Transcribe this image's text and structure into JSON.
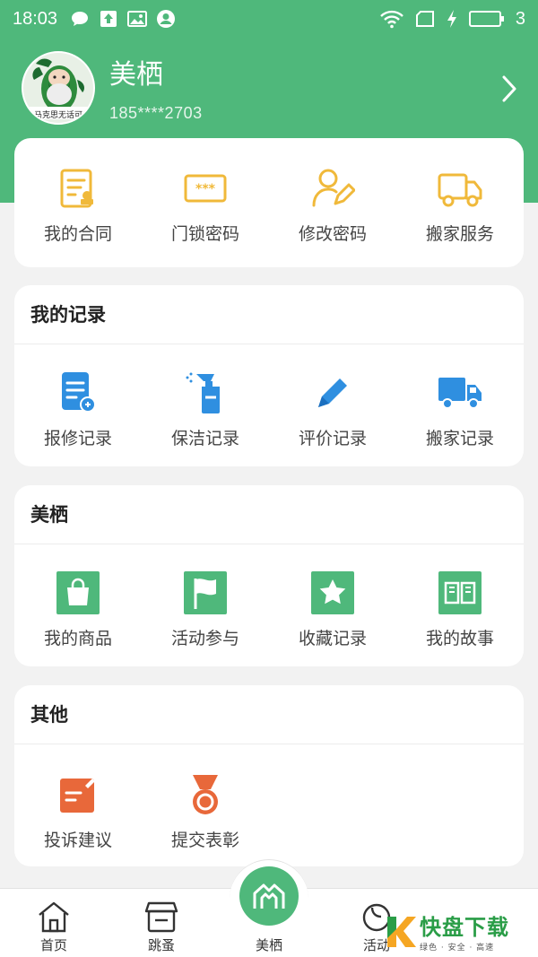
{
  "status_bar": {
    "time": "18:03",
    "battery_level": "3",
    "icons": [
      "chat-bubble-icon",
      "upload-icon",
      "image-icon",
      "user-circle-icon",
      "wifi-icon",
      "sim-icon",
      "charging-icon",
      "battery-icon"
    ]
  },
  "profile": {
    "avatar_caption": "马克思无话可",
    "name": "美栖",
    "phone": "185****2703"
  },
  "colors": {
    "brand": "#4fb87b",
    "gold": "#f0b93a",
    "blue": "#2f8fe0",
    "green_icon": "#4fb87b",
    "orange": "#e8683a"
  },
  "quick_actions": [
    {
      "label": "我的合同",
      "icon": "contract-icon"
    },
    {
      "label": "门锁密码",
      "icon": "door-lock-password-icon"
    },
    {
      "label": "修改密码",
      "icon": "user-edit-icon"
    },
    {
      "label": "搬家服务",
      "icon": "moving-truck-icon"
    }
  ],
  "records": {
    "title": "我的记录",
    "items": [
      {
        "label": "报修记录",
        "icon": "repair-record-icon"
      },
      {
        "label": "保洁记录",
        "icon": "cleaning-spray-icon"
      },
      {
        "label": "评价记录",
        "icon": "pencil-icon"
      },
      {
        "label": "搬家记录",
        "icon": "truck-icon"
      }
    ]
  },
  "meiqi": {
    "title": "美栖",
    "items": [
      {
        "label": "我的商品",
        "icon": "shopping-bag-icon"
      },
      {
        "label": "活动参与",
        "icon": "flag-icon"
      },
      {
        "label": "收藏记录",
        "icon": "star-icon"
      },
      {
        "label": "我的故事",
        "icon": "book-icon"
      }
    ]
  },
  "other": {
    "title": "其他",
    "items": [
      {
        "label": "投诉建议",
        "icon": "complaint-note-icon"
      },
      {
        "label": "提交表彰",
        "icon": "medal-icon"
      }
    ]
  },
  "tabbar": {
    "items": [
      {
        "label": "首页",
        "icon": "home-icon"
      },
      {
        "label": "跳蚤",
        "icon": "shop-icon"
      },
      {
        "label": "美栖",
        "icon": "meiqi-house-icon"
      },
      {
        "label": "活动",
        "icon": "activity-icon"
      }
    ]
  },
  "watermark": {
    "title": "快盘下载",
    "subtitle": "绿色 · 安全 · 高速"
  }
}
